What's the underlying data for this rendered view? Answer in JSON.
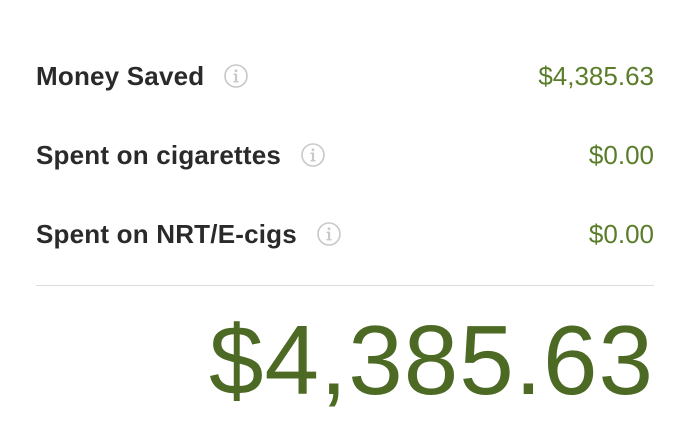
{
  "summary": {
    "rows": [
      {
        "label": "Money Saved",
        "value": "$4,385.63",
        "icon": "info-icon"
      },
      {
        "label": "Spent on cigarettes",
        "value": "$0.00",
        "icon": "info-icon"
      },
      {
        "label": "Spent on NRT/E-cigs",
        "value": "$0.00",
        "icon": "info-icon"
      }
    ],
    "total": "$4,385.63"
  },
  "colors": {
    "value_green": "#5a7d2a",
    "total_green": "#4c6a24",
    "label_text": "#2a2a2a",
    "icon_gray": "#c8c8c8",
    "divider": "#dcdcdc"
  }
}
